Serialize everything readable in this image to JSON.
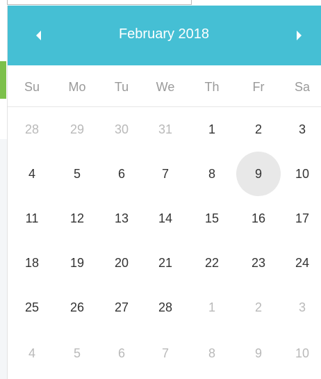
{
  "datepicker": {
    "title": "February 2018",
    "prev_icon": "chevron-left-icon",
    "next_icon": "chevron-right-icon",
    "header_color": "#45bfd4",
    "weekdays": [
      "Su",
      "Mo",
      "Tu",
      "We",
      "Th",
      "Fr",
      "Sa"
    ],
    "selected_day": "9",
    "weeks": [
      [
        {
          "label": "28",
          "muted": true
        },
        {
          "label": "29",
          "muted": true
        },
        {
          "label": "30",
          "muted": true
        },
        {
          "label": "31",
          "muted": true
        },
        {
          "label": "1",
          "muted": false
        },
        {
          "label": "2",
          "muted": false
        },
        {
          "label": "3",
          "muted": false
        }
      ],
      [
        {
          "label": "4",
          "muted": false
        },
        {
          "label": "5",
          "muted": false
        },
        {
          "label": "6",
          "muted": false
        },
        {
          "label": "7",
          "muted": false
        },
        {
          "label": "8",
          "muted": false
        },
        {
          "label": "9",
          "muted": false,
          "selected": true
        },
        {
          "label": "10",
          "muted": false
        }
      ],
      [
        {
          "label": "11",
          "muted": false
        },
        {
          "label": "12",
          "muted": false
        },
        {
          "label": "13",
          "muted": false
        },
        {
          "label": "14",
          "muted": false
        },
        {
          "label": "15",
          "muted": false
        },
        {
          "label": "16",
          "muted": false
        },
        {
          "label": "17",
          "muted": false
        }
      ],
      [
        {
          "label": "18",
          "muted": false
        },
        {
          "label": "19",
          "muted": false
        },
        {
          "label": "20",
          "muted": false
        },
        {
          "label": "21",
          "muted": false
        },
        {
          "label": "22",
          "muted": false
        },
        {
          "label": "23",
          "muted": false
        },
        {
          "label": "24",
          "muted": false
        }
      ],
      [
        {
          "label": "25",
          "muted": false
        },
        {
          "label": "26",
          "muted": false
        },
        {
          "label": "27",
          "muted": false
        },
        {
          "label": "28",
          "muted": false
        },
        {
          "label": "1",
          "muted": true
        },
        {
          "label": "2",
          "muted": true
        },
        {
          "label": "3",
          "muted": true
        }
      ],
      [
        {
          "label": "4",
          "muted": true
        },
        {
          "label": "5",
          "muted": true
        },
        {
          "label": "6",
          "muted": true
        },
        {
          "label": "7",
          "muted": true
        },
        {
          "label": "8",
          "muted": true
        },
        {
          "label": "9",
          "muted": true
        },
        {
          "label": "10",
          "muted": true
        }
      ]
    ]
  }
}
